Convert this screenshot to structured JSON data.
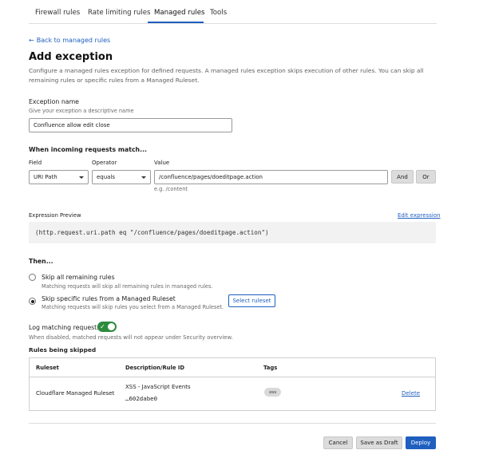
{
  "tabs": [
    {
      "label": "Firewall rules"
    },
    {
      "label": "Rate limiting rules"
    },
    {
      "label": "Managed rules"
    },
    {
      "label": "Tools"
    }
  ],
  "active_tab": "Managed rules",
  "accent_color": "#1f5fbf",
  "back_link": "Back to managed rules",
  "page": {
    "title": "Add exception",
    "description": "Configure a managed rules exception for defined requests. A managed rules exception skips execution of other rules. You can skip all remaining rules or specific rules from a Managed Ruleset."
  },
  "exception_name": {
    "label": "Exception name",
    "hint": "Give your exception a descriptive name",
    "value": "Confluence allow edit close"
  },
  "match": {
    "heading": "When incoming requests match...",
    "field_label": "Field",
    "operator_label": "Operator",
    "value_label": "Value",
    "field_value": "URI Path",
    "operator_value": "equals",
    "value_value": "/confluence/pages/doeditpage.action",
    "value_example": "e.g. /content",
    "and_label": "And",
    "or_label": "Or"
  },
  "expression": {
    "label": "Expression Preview",
    "edit_link": "Edit expression",
    "code": "(http.request.uri.path eq \"/confluence/pages/doeditpage.action\")"
  },
  "then": {
    "heading": "Then...",
    "options": [
      {
        "title": "Skip all remaining rules",
        "sub": "Matching requests will skip all remaining rules in managed rules.",
        "checked": false
      },
      {
        "title": "Skip specific rules from a Managed Ruleset",
        "sub": "Matching requests will skip rules you select from a Managed Ruleset.",
        "checked": true
      }
    ],
    "select_ruleset": "Select ruleset"
  },
  "logging": {
    "label": "Log matching requests",
    "enabled": true,
    "toggle_color": "#2e8b3e",
    "hint": "When disabled, matched requests will not appear under Security overview."
  },
  "skipped": {
    "heading": "Rules being skipped",
    "columns": [
      "Ruleset",
      "Description/Rule ID",
      "Tags"
    ],
    "rows": [
      {
        "ruleset": "Cloudflare Managed Ruleset",
        "description": "XSS - JavaScript Events",
        "rule_id": "…602dabe0",
        "tag": "xss",
        "action": "Delete"
      }
    ]
  },
  "footer": {
    "cancel": "Cancel",
    "save_draft": "Save as Draft",
    "deploy": "Deploy"
  }
}
